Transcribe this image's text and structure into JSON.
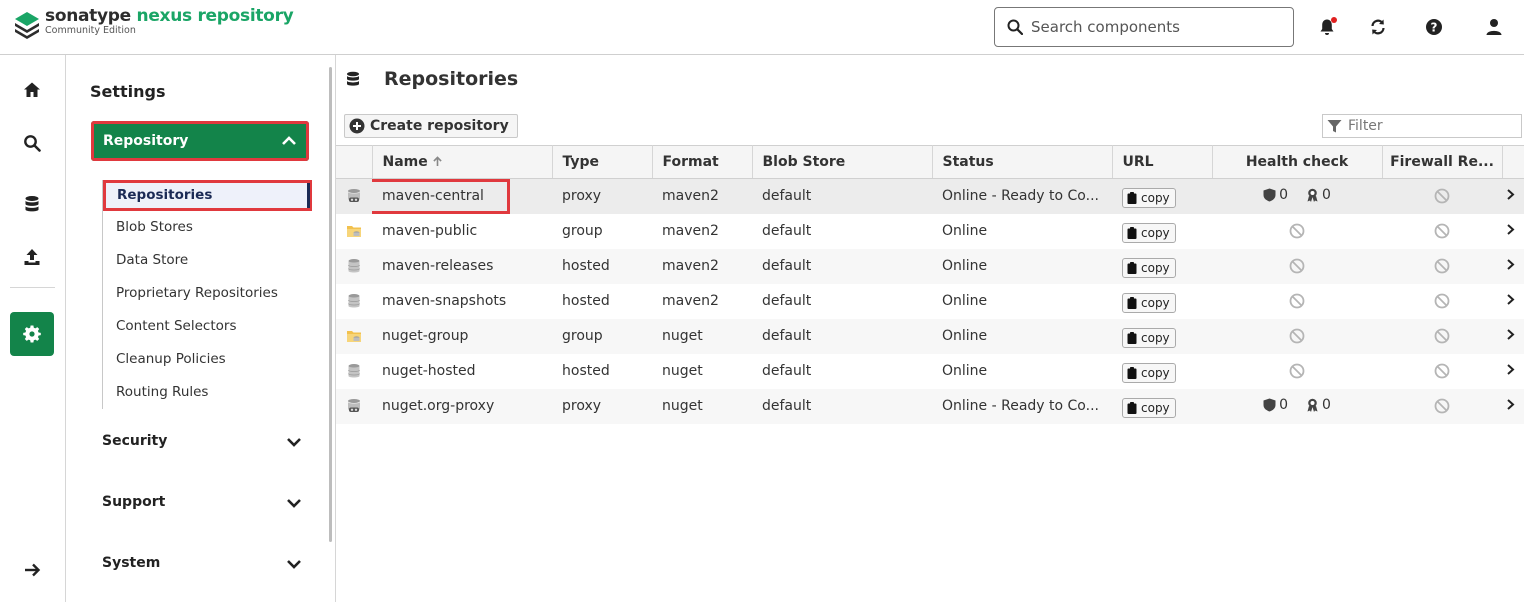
{
  "brand": {
    "name_part1": "sonatype",
    "name_part2": "nexus repository",
    "edition": "Community Edition"
  },
  "search": {
    "placeholder": "Search components"
  },
  "topbar_icons": [
    "bell-icon",
    "refresh-icon",
    "help-icon",
    "user-icon"
  ],
  "rail": [
    "home-icon",
    "search-icon",
    "database-icon",
    "upload-icon",
    "gear-icon",
    "arrow-right-icon"
  ],
  "sidebar": {
    "title": "Settings",
    "repository_label": "Repository",
    "sub_items": [
      "Repositories",
      "Blob Stores",
      "Data Store",
      "Proprietary Repositories",
      "Content Selectors",
      "Cleanup Policies",
      "Routing Rules"
    ],
    "groups": [
      "Security",
      "Support",
      "System"
    ]
  },
  "main": {
    "title": "Repositories",
    "create_label": "Create repository",
    "filter_placeholder": "Filter",
    "columns": [
      "Name",
      "Type",
      "Format",
      "Blob Store",
      "Status",
      "URL",
      "Health check",
      "Firewall Re..."
    ],
    "copy_label": "copy",
    "rows": [
      {
        "name": "maven-central",
        "type": "proxy",
        "format": "maven2",
        "blob": "default",
        "status": "Online - Ready to Co...",
        "icon": "proxy-icon",
        "health": [
          "0",
          "0"
        ]
      },
      {
        "name": "maven-public",
        "type": "group",
        "format": "maven2",
        "blob": "default",
        "status": "Online",
        "icon": "group-folder-icon"
      },
      {
        "name": "maven-releases",
        "type": "hosted",
        "format": "maven2",
        "blob": "default",
        "status": "Online",
        "icon": "hosted-db-icon"
      },
      {
        "name": "maven-snapshots",
        "type": "hosted",
        "format": "maven2",
        "blob": "default",
        "status": "Online",
        "icon": "hosted-db-icon"
      },
      {
        "name": "nuget-group",
        "type": "group",
        "format": "nuget",
        "blob": "default",
        "status": "Online",
        "icon": "group-folder-icon"
      },
      {
        "name": "nuget-hosted",
        "type": "hosted",
        "format": "nuget",
        "blob": "default",
        "status": "Online",
        "icon": "hosted-db-icon"
      },
      {
        "name": "nuget.org-proxy",
        "type": "proxy",
        "format": "nuget",
        "blob": "default",
        "status": "Online - Ready to Co...",
        "icon": "proxy-icon",
        "health": [
          "0",
          "0"
        ]
      }
    ]
  },
  "colors": {
    "brand_green": "#13844a",
    "logo_green": "#1aa566",
    "highlight_red": "#e0393e",
    "nav_active": "#1b2a55"
  }
}
